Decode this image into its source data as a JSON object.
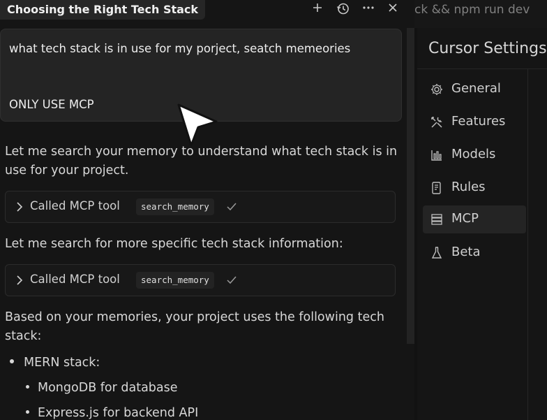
{
  "header": {
    "title": "Choosing the Right Tech Stack",
    "icons": [
      "plus-icon",
      "history-icon",
      "more-icon",
      "close-icon"
    ]
  },
  "prompt": {
    "line1": "what tech stack is in use for my porject, seatch memeories",
    "line2": "ONLY USE MCP"
  },
  "messages": {
    "p1": "Let me search your memory to understand what tech stack is in use for your project.",
    "tool1": {
      "label": "Called MCP tool",
      "code": "search_memory"
    },
    "p2": "Let me search for more specific tech stack information:",
    "tool2": {
      "label": "Called MCP tool",
      "code": "search_memory"
    },
    "p3": "Based on your memories, your project uses the following tech stack:",
    "bullets": [
      "MERN stack:",
      "MongoDB for database",
      "Express.js for backend API"
    ]
  },
  "terminal": {
    "command_fragment": "ck && npm run dev"
  },
  "settings": {
    "title": "Cursor Settings",
    "nav": [
      {
        "label": "General",
        "icon": "gear-icon"
      },
      {
        "label": "Features",
        "icon": "tools-icon"
      },
      {
        "label": "Models",
        "icon": "chart-icon"
      },
      {
        "label": "Rules",
        "icon": "document-icon"
      },
      {
        "label": "MCP",
        "icon": "server-icon",
        "active": true
      },
      {
        "label": "Beta",
        "icon": "flask-icon"
      }
    ]
  },
  "colors": {
    "background": "#141414",
    "panel": "#242424",
    "text": "#e6e6e6",
    "muted": "#9a9a9a"
  }
}
